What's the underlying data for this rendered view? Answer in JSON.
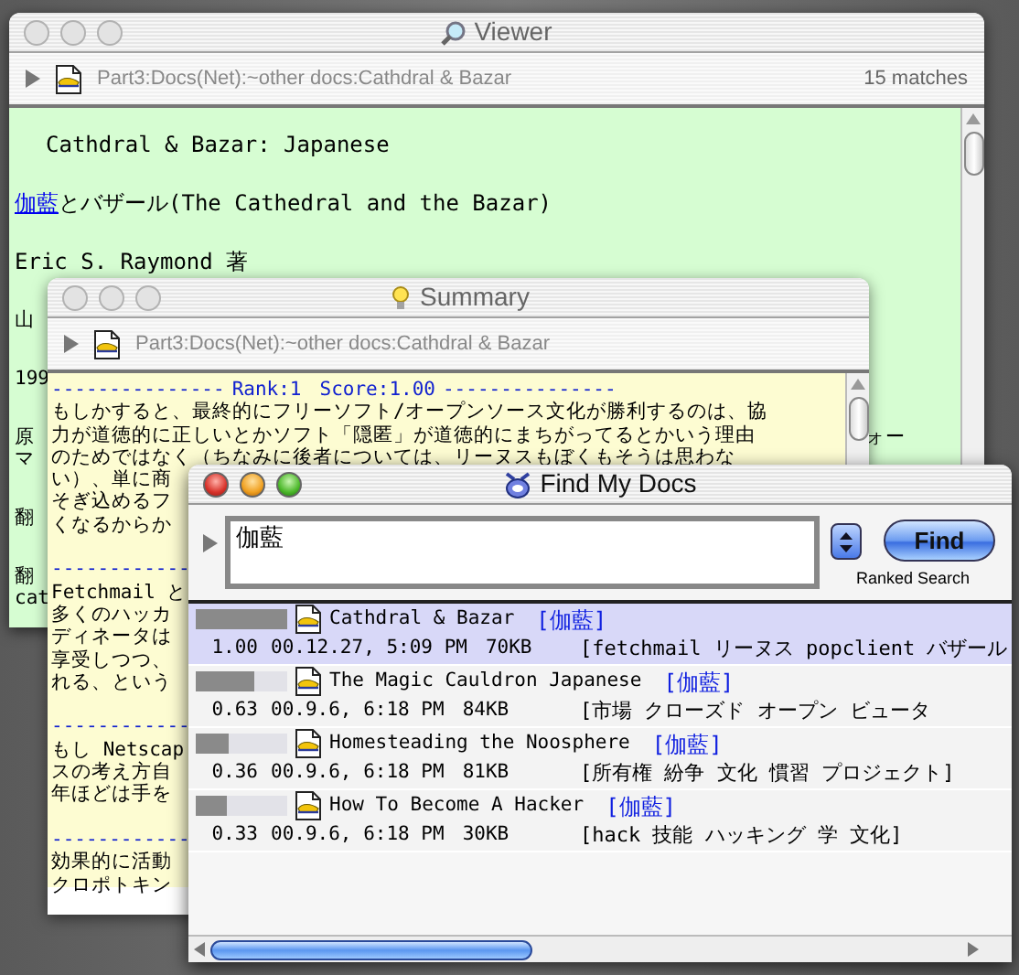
{
  "viewer": {
    "title": "Viewer",
    "active": false,
    "path": "Part3:Docs(Net):~other docs:Cathdral & Bazar",
    "matches": "15 matches",
    "paragraphs": [
      [
        {
          "text": "Cathdral & Bazar: Japanese"
        }
      ],
      [
        {
          "match": "伽藍",
          "text": "とバザール(The Cathedral and the Bazar)"
        }
      ],
      [
        {
          "text": "Eric S. Raymond 著"
        }
      ],
      [
        {
          "text": "山"
        }
      ],
      [
        {
          "text": "199"
        }
      ],
      [
        {
          "text": "原",
          "tail": "ォー"
        },
        {
          "text": "マ"
        }
      ],
      [
        {
          "text": "翻"
        }
      ],
      [
        {
          "text": "翻"
        },
        {
          "text": "cat"
        }
      ]
    ]
  },
  "summary": {
    "title": "Summary",
    "active": false,
    "path": "Part3:Docs(Net):~other docs:Cathdral & Bazar",
    "blocks": [
      {
        "kind": "rank",
        "rule_left": "---------------",
        "rank": "Rank:1",
        "score": "Score:1.00",
        "rule_right": "---------------"
      },
      {
        "kind": "text",
        "lines": [
          "もしかすると、最終的にフリーソフト/オープンソース文化が勝利するのは、協",
          "力が道徳的に正しいとかソフト「隠匿」が道徳的にまちがってるとかいう理由",
          "のためではなく（ちなみに後者については、リーヌスもぼくもそうは思わな",
          "い）、単に商",
          "そぎ込めるフ",
          "くなるからか"
        ]
      },
      {
        "kind": "rule",
        "text": "------------"
      },
      {
        "kind": "text",
        "lines": [
          "Fetchmail と",
          "多くのハッカ",
          "ディネータは",
          "享受しつつ、",
          "れる、という"
        ]
      },
      {
        "kind": "rule",
        "text": "------------"
      },
      {
        "kind": "text",
        "lines": [
          "もし Netscap",
          "スの考え方自",
          "年ほどは手を"
        ]
      },
      {
        "kind": "rule",
        "text": "------------"
      },
      {
        "kind": "text",
        "lines": [
          "効果的に活動",
          "クロポトキン"
        ]
      }
    ]
  },
  "find": {
    "title": "Find My Docs",
    "active": true,
    "query": "伽藍",
    "find_button": "Find",
    "mode": "Ranked Search",
    "results": [
      {
        "name": "Cathdral & Bazar",
        "match": "[伽藍]",
        "score": "1.00",
        "date": "00.12.27, 5:09 PM",
        "size": "70KB",
        "keywords": "[fetchmail リーヌス popclient バザール",
        "level": 1.0,
        "selected": true
      },
      {
        "name": "The Magic Cauldron Japanese",
        "match": "[伽藍]",
        "score": "0.63",
        "date": "00.9.6, 6:18 PM",
        "size": "84KB",
        "keywords": "[市場 クローズド オープン ビュータ",
        "level": 0.63,
        "selected": false
      },
      {
        "name": "Homesteading the Noosphere",
        "match": "[伽藍]",
        "score": "0.36",
        "date": "00.9.6, 6:18 PM",
        "size": "81KB",
        "keywords": "[所有権 紛争 文化 慣習 プロジェクト]",
        "level": 0.36,
        "selected": false
      },
      {
        "name": "How To Become A Hacker",
        "match": "[伽藍]",
        "score": "0.33",
        "date": "00.9.6, 6:18 PM",
        "size": "30KB",
        "keywords": "[hack 技能 ハッキング 学 文化]",
        "level": 0.33,
        "selected": false
      }
    ]
  }
}
